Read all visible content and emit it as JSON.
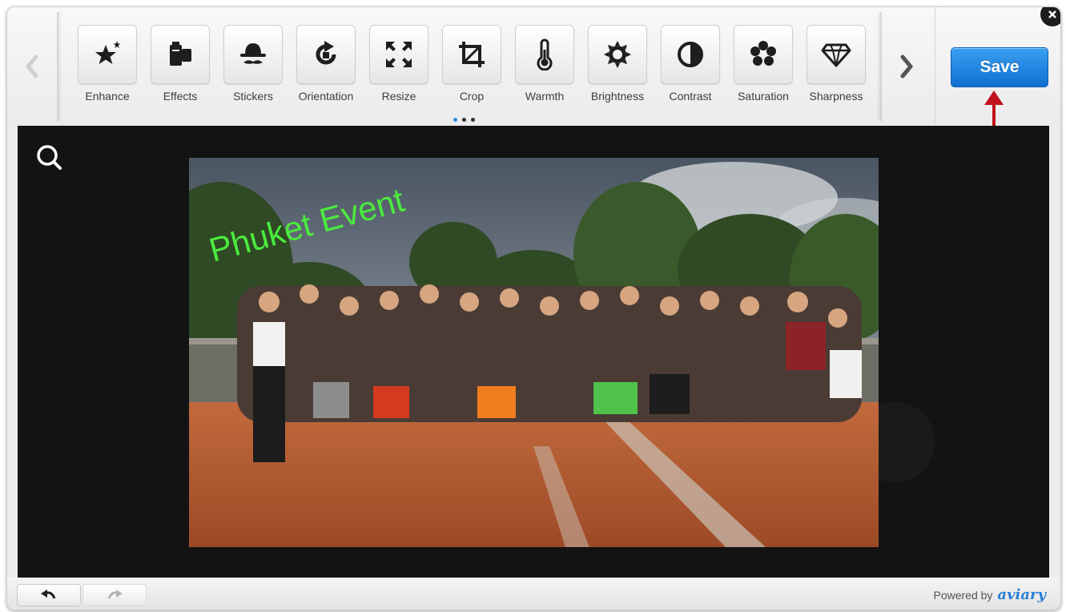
{
  "toolbar": {
    "tools": [
      {
        "label": "Enhance",
        "icon": "enhance-icon"
      },
      {
        "label": "Effects",
        "icon": "effects-icon"
      },
      {
        "label": "Stickers",
        "icon": "stickers-icon"
      },
      {
        "label": "Orientation",
        "icon": "orientation-icon"
      },
      {
        "label": "Resize",
        "icon": "resize-icon"
      },
      {
        "label": "Crop",
        "icon": "crop-icon"
      },
      {
        "label": "Warmth",
        "icon": "thermometer-icon"
      },
      {
        "label": "Brightness",
        "icon": "sun-icon"
      },
      {
        "label": "Contrast",
        "icon": "contrast-icon"
      },
      {
        "label": "Saturation",
        "icon": "saturation-icon"
      },
      {
        "label": "Sharpness",
        "icon": "diamond-icon"
      }
    ],
    "page_dots": 3,
    "active_page": 1,
    "save_label": "Save"
  },
  "canvas": {
    "photo_caption": "Phuket Event"
  },
  "footer": {
    "powered_by": "Powered by",
    "brand": "aviary"
  },
  "colors": {
    "save_button": "#1a7fe0",
    "caption_text": "#4bea3e",
    "annotation_arrow": "#c0121c",
    "canvas_background": "#131313"
  }
}
